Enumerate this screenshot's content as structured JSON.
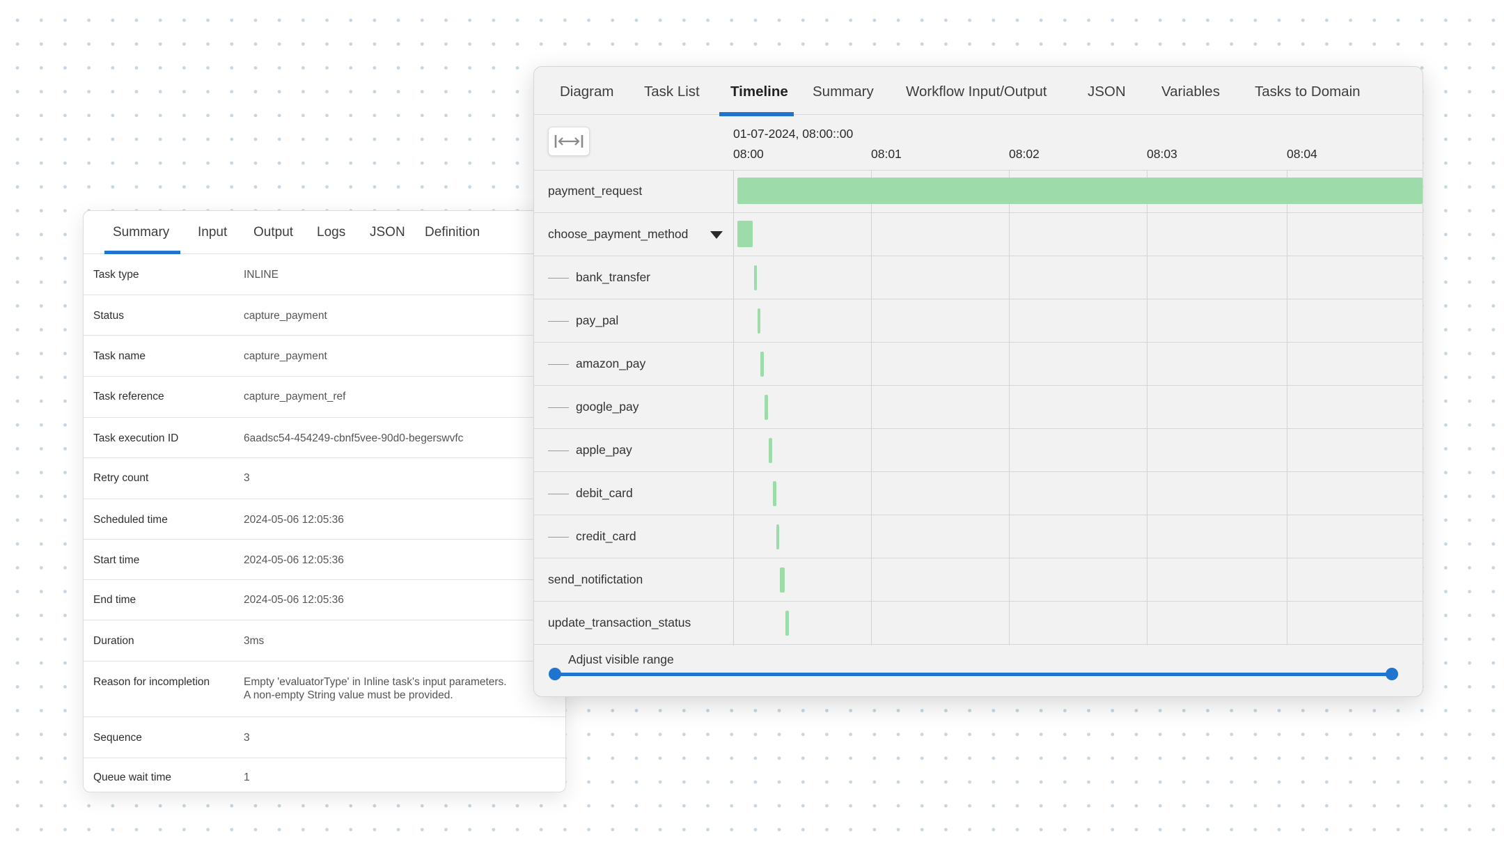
{
  "task_panel": {
    "tabs": [
      {
        "label": "Summary",
        "active": true
      },
      {
        "label": "Input",
        "active": false
      },
      {
        "label": "Output",
        "active": false
      },
      {
        "label": "Logs",
        "active": false
      },
      {
        "label": "JSON",
        "active": false
      },
      {
        "label": "Definition",
        "active": false
      }
    ],
    "rows": [
      {
        "key": "Task type",
        "value": "INLINE"
      },
      {
        "key": "Status",
        "value": "capture_payment"
      },
      {
        "key": "Task name",
        "value": "capture_payment"
      },
      {
        "key": "Task reference",
        "value": "capture_payment_ref"
      },
      {
        "key": "Task execution ID",
        "value": "6aadsc54-454249-cbnf5vee-90d0-begerswvfc"
      },
      {
        "key": "Retry count",
        "value": "3"
      },
      {
        "key": "Scheduled time",
        "value": "2024-05-06 12:05:36"
      },
      {
        "key": "Start time",
        "value": "2024-05-06 12:05:36"
      },
      {
        "key": "End time",
        "value": "2024-05-06 12:05:36"
      },
      {
        "key": "Duration",
        "value": "3ms"
      },
      {
        "key": "Reason for incompletion",
        "value": "Empty 'evaluatorType' in Inline task's input parameters.",
        "value_line2": "A non-empty String value must be provided."
      },
      {
        "key": "Sequence",
        "value": "3"
      },
      {
        "key": "Queue wait time",
        "value": "1"
      }
    ]
  },
  "workflow_panel": {
    "tabs": [
      {
        "label": "Diagram",
        "active": false
      },
      {
        "label": "Task List",
        "active": false
      },
      {
        "label": "Timeline",
        "active": true
      },
      {
        "label": "Summary",
        "active": false
      },
      {
        "label": "Workflow Input/Output",
        "active": false
      },
      {
        "label": "JSON",
        "active": false
      },
      {
        "label": "Variables",
        "active": false
      },
      {
        "label": "Tasks to Domain",
        "active": false
      }
    ],
    "fit_button_icon": "fit-width-icon",
    "timeline": {
      "date_label": "01-07-2024, 08:00::00",
      "ticks": [
        "08:00",
        "08:01",
        "08:02",
        "08:03",
        "08:04"
      ],
      "accent_color": "#1f74d0",
      "bar_color": "#9edbaa",
      "tasks": [
        {
          "label": "payment_request",
          "child": false,
          "start_min": 0.03,
          "end_min": 5.0
        },
        {
          "label": "choose_payment_method",
          "child": false,
          "has_dropdown": true,
          "start_min": 0.03,
          "end_min": 0.14
        },
        {
          "label": "bank_transfer",
          "child": true,
          "start_min": 0.15,
          "end_min": 0.165
        },
        {
          "label": "pay_pal",
          "child": true,
          "start_min": 0.175,
          "end_min": 0.19
        },
        {
          "label": "amazon_pay",
          "child": true,
          "start_min": 0.195,
          "end_min": 0.22
        },
        {
          "label": "google_pay",
          "child": true,
          "start_min": 0.225,
          "end_min": 0.25
        },
        {
          "label": "apple_pay",
          "child": true,
          "start_min": 0.255,
          "end_min": 0.28
        },
        {
          "label": "debit_card",
          "child": true,
          "start_min": 0.285,
          "end_min": 0.31
        },
        {
          "label": "credit_card",
          "child": true,
          "start_min": 0.31,
          "end_min": 0.335
        },
        {
          "label": "send_notifictation",
          "child": false,
          "start_min": 0.34,
          "end_min": 0.375
        },
        {
          "label": "update_transaction_status",
          "child": false,
          "start_min": 0.38,
          "end_min": 0.405
        }
      ]
    },
    "range": {
      "label": "Adjust visible range",
      "start": 0,
      "end": 1
    }
  }
}
